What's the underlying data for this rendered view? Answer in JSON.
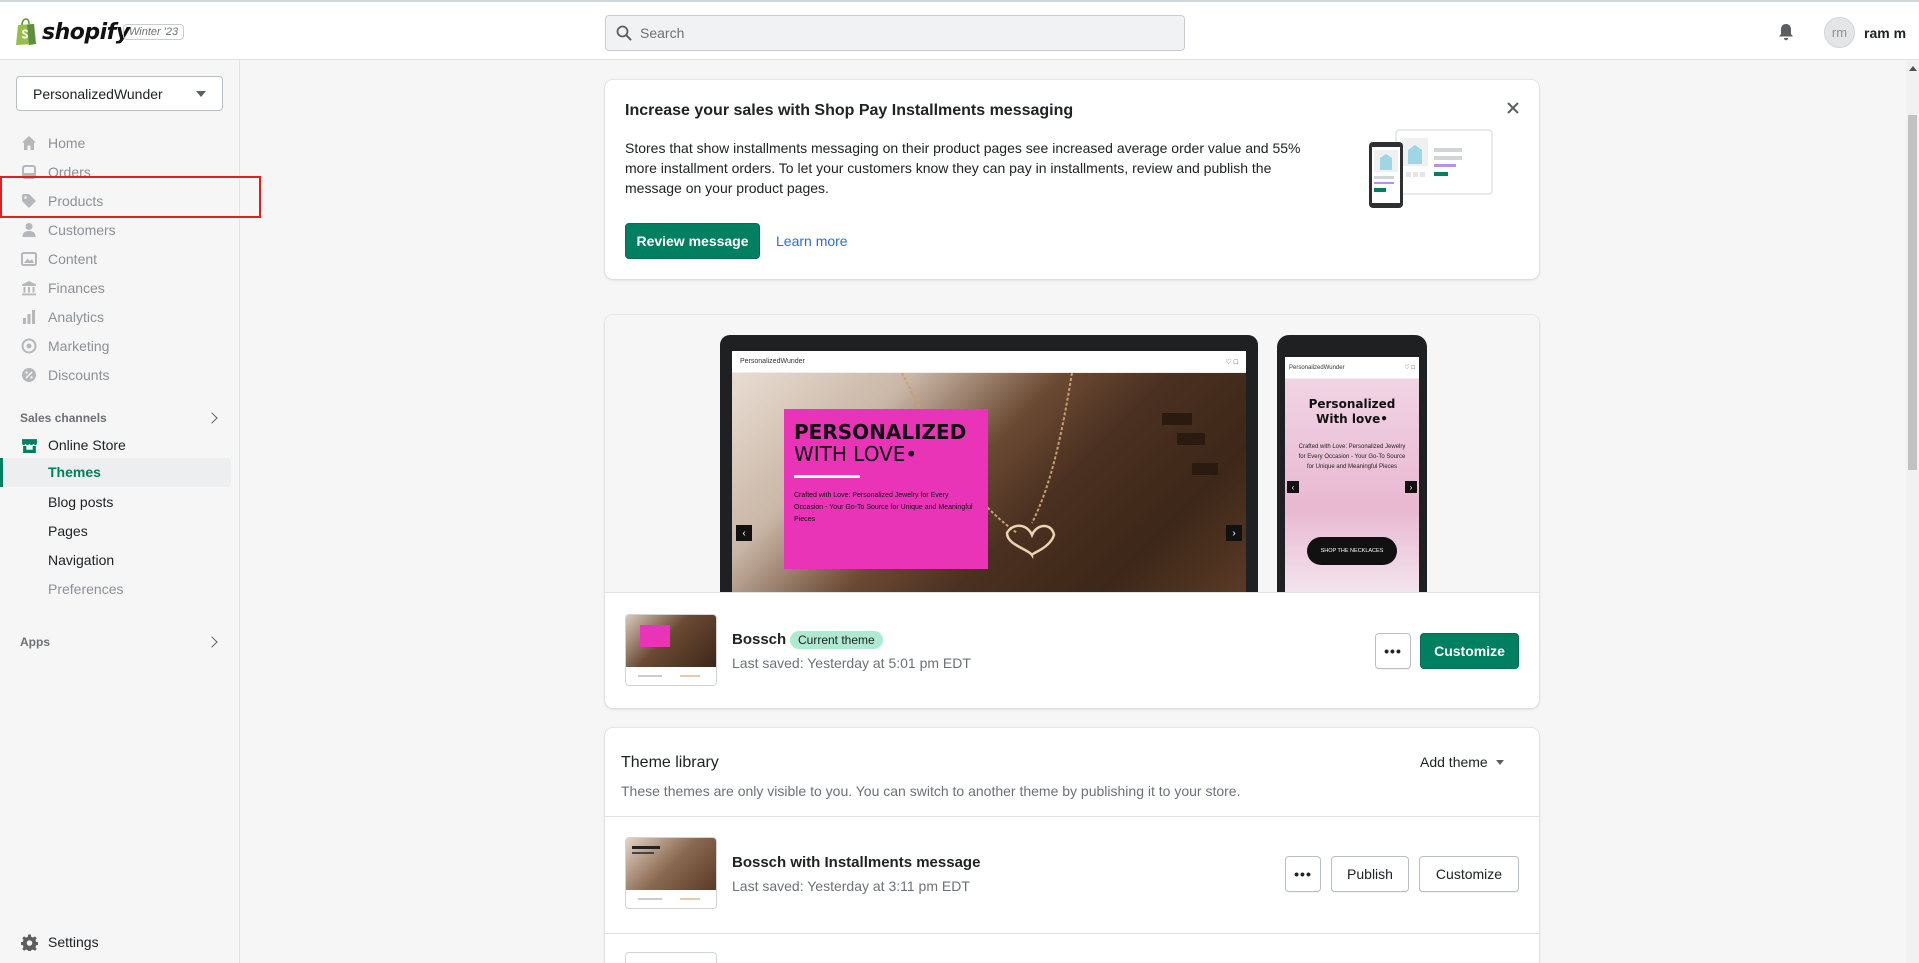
{
  "topbar": {
    "brand": "shopify",
    "version_badge": "Winter '23",
    "search_placeholder": "Search",
    "avatar_initials": "rm",
    "user_name": "ram m"
  },
  "sidebar": {
    "store_name": "PersonalizedWunder",
    "nav": [
      {
        "label": "Home",
        "icon": "home-icon"
      },
      {
        "label": "Orders",
        "icon": "orders-icon"
      },
      {
        "label": "Products",
        "icon": "tag-icon"
      },
      {
        "label": "Customers",
        "icon": "person-icon"
      },
      {
        "label": "Content",
        "icon": "image-icon"
      },
      {
        "label": "Finances",
        "icon": "bank-icon"
      },
      {
        "label": "Analytics",
        "icon": "bar-chart-icon"
      },
      {
        "label": "Marketing",
        "icon": "target-icon"
      },
      {
        "label": "Discounts",
        "icon": "discount-icon"
      }
    ],
    "sales_channels_title": "Sales channels",
    "online_store_label": "Online Store",
    "online_store_sub": [
      "Themes",
      "Blog posts",
      "Pages",
      "Navigation",
      "Preferences"
    ],
    "apps_title": "Apps",
    "settings_label": "Settings"
  },
  "banner": {
    "title": "Increase your sales with Shop Pay Installments messaging",
    "body": "Stores that show installments messaging on their product pages see increased average order value and 55% more installment orders. To let your customers know they can pay in installments, review and publish the message on your product pages.",
    "primary_button": "Review message",
    "link": "Learn more"
  },
  "current_theme": {
    "preview_store_name": "PersonalizedWunder",
    "hero_title_line1": "PERSONALIZED",
    "hero_title_line2": "WITH LOVE•",
    "hero_subtitle": "Crafted with Love: Personalized Jewelry for Every Occasion - Your Go-To Source for Unique and Meaningful Pieces",
    "phone_title": "Personalized With love•",
    "phone_subtitle": "Crafted with Love: Personalized Jewelry for Every Occasion - Your Go-To Source for Unique and Meaningful Pieces",
    "phone_button": "SHOP THE NECKLACES",
    "name": "Bossch",
    "badge": "Current theme",
    "last_saved": "Last saved: Yesterday at 5:01 pm EDT",
    "more_button": "•••",
    "customize_button": "Customize"
  },
  "library": {
    "title": "Theme library",
    "description": "These themes are only visible to you. You can switch to another theme by publishing it to your store.",
    "add_theme": "Add theme",
    "themes": [
      {
        "name": "Bossch with Installments message",
        "last_saved": "Last saved: Yesterday at 3:11 pm EDT",
        "more_button": "•••",
        "publish_button": "Publish",
        "customize_button": "Customize"
      }
    ]
  },
  "colors": {
    "accent": "#008060",
    "highlight_box": "#e02020",
    "badge_bg": "#aee9d1",
    "hero_pink": "#e934b7"
  }
}
